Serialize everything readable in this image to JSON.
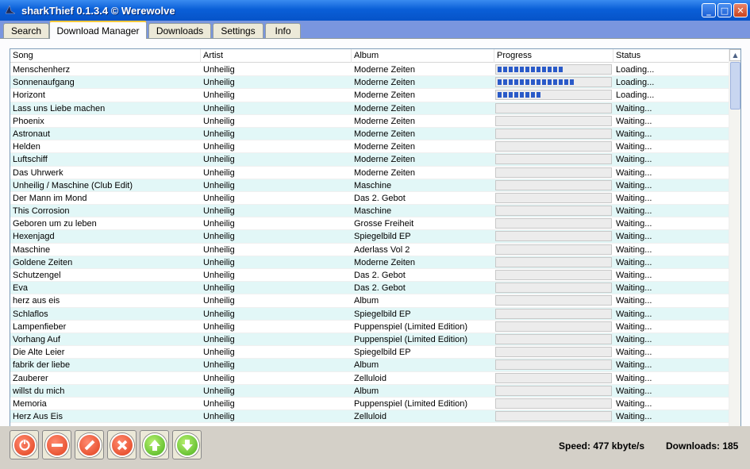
{
  "window": {
    "title": "sharkThief 0.1.3.4 © Werewolve"
  },
  "tabs": [
    {
      "label": "Search"
    },
    {
      "label": "Download Manager"
    },
    {
      "label": "Downloads"
    },
    {
      "label": "Settings"
    },
    {
      "label": "Info"
    }
  ],
  "columns": {
    "song": "Song",
    "artist": "Artist",
    "album": "Album",
    "progress": "Progress",
    "status": "Status"
  },
  "rows": [
    {
      "song": "Menschenherz",
      "artist": "Unheilig",
      "album": "Moderne Zeiten",
      "progress": 0.58,
      "status": "Loading..."
    },
    {
      "song": "Sonnenaufgang",
      "artist": "Unheilig",
      "album": "Moderne Zeiten",
      "progress": 0.68,
      "status": "Loading..."
    },
    {
      "song": "Horizont",
      "artist": "Unheilig",
      "album": "Moderne Zeiten",
      "progress": 0.39,
      "status": "Loading..."
    },
    {
      "song": "Lass uns Liebe machen",
      "artist": "Unheilig",
      "album": "Moderne Zeiten",
      "progress": 0,
      "status": "Waiting..."
    },
    {
      "song": "Phoenix",
      "artist": "Unheilig",
      "album": "Moderne Zeiten",
      "progress": 0,
      "status": "Waiting..."
    },
    {
      "song": "Astronaut",
      "artist": "Unheilig",
      "album": "Moderne Zeiten",
      "progress": 0,
      "status": "Waiting..."
    },
    {
      "song": "Helden",
      "artist": "Unheilig",
      "album": "Moderne Zeiten",
      "progress": 0,
      "status": "Waiting..."
    },
    {
      "song": "Luftschiff",
      "artist": "Unheilig",
      "album": "Moderne Zeiten",
      "progress": 0,
      "status": "Waiting..."
    },
    {
      "song": "Das Uhrwerk",
      "artist": "Unheilig",
      "album": "Moderne Zeiten",
      "progress": 0,
      "status": "Waiting..."
    },
    {
      "song": "Unheilig / Maschine (Club Edit)",
      "artist": "Unheilig",
      "album": "Maschine",
      "progress": 0,
      "status": "Waiting..."
    },
    {
      "song": "Der Mann im Mond",
      "artist": "Unheilig",
      "album": "Das 2. Gebot",
      "progress": 0,
      "status": "Waiting..."
    },
    {
      "song": "This Corrosion",
      "artist": "Unheilig",
      "album": "Maschine",
      "progress": 0,
      "status": "Waiting..."
    },
    {
      "song": "Geboren um zu leben",
      "artist": "Unheilig",
      "album": "Grosse Freiheit",
      "progress": 0,
      "status": "Waiting..."
    },
    {
      "song": "Hexenjagd",
      "artist": "Unheilig",
      "album": "Spiegelbild EP",
      "progress": 0,
      "status": "Waiting..."
    },
    {
      "song": "Maschine",
      "artist": "Unheilig",
      "album": "Aderlass Vol 2",
      "progress": 0,
      "status": "Waiting..."
    },
    {
      "song": "Goldene Zeiten",
      "artist": "Unheilig",
      "album": "Moderne Zeiten",
      "progress": 0,
      "status": "Waiting..."
    },
    {
      "song": "Schutzengel",
      "artist": "Unheilig",
      "album": "Das 2. Gebot",
      "progress": 0,
      "status": "Waiting..."
    },
    {
      "song": "Eva",
      "artist": "Unheilig",
      "album": "Das 2. Gebot",
      "progress": 0,
      "status": "Waiting..."
    },
    {
      "song": "herz aus eis",
      "artist": "Unheilig",
      "album": "Album",
      "progress": 0,
      "status": "Waiting..."
    },
    {
      "song": "Schlaflos",
      "artist": "Unheilig",
      "album": "Spiegelbild EP",
      "progress": 0,
      "status": "Waiting..."
    },
    {
      "song": "Lampenfieber",
      "artist": "Unheilig",
      "album": "Puppenspiel (Limited Edition)",
      "progress": 0,
      "status": "Waiting..."
    },
    {
      "song": "Vorhang Auf",
      "artist": "Unheilig",
      "album": "Puppenspiel (Limited Edition)",
      "progress": 0,
      "status": "Waiting..."
    },
    {
      "song": "Die Alte Leier",
      "artist": "Unheilig",
      "album": "Spiegelbild EP",
      "progress": 0,
      "status": "Waiting..."
    },
    {
      "song": "fabrik der  liebe",
      "artist": "Unheilig",
      "album": "Album",
      "progress": 0,
      "status": "Waiting..."
    },
    {
      "song": "Zauberer",
      "artist": "Unheilig",
      "album": "Zelluloid",
      "progress": 0,
      "status": "Waiting..."
    },
    {
      "song": "willst du mich",
      "artist": "Unheilig",
      "album": "Album",
      "progress": 0,
      "status": "Waiting..."
    },
    {
      "song": "Memoria",
      "artist": "Unheilig",
      "album": "Puppenspiel (Limited Edition)",
      "progress": 0,
      "status": "Waiting..."
    },
    {
      "song": "Herz Aus Eis",
      "artist": "Unheilig",
      "album": "Zelluloid",
      "progress": 0,
      "status": "Waiting..."
    }
  ],
  "actions": [
    {
      "name": "power-button",
      "icon": "power-icon",
      "color": "red"
    },
    {
      "name": "remove-button",
      "icon": "minus-icon",
      "color": "red"
    },
    {
      "name": "clear-button",
      "icon": "slash-icon",
      "color": "red"
    },
    {
      "name": "cancel-button",
      "icon": "x-icon",
      "color": "red"
    },
    {
      "name": "move-up-button",
      "icon": "arrow-up-icon",
      "color": "green"
    },
    {
      "name": "move-down-button",
      "icon": "arrow-down-icon",
      "color": "green"
    }
  ],
  "status": {
    "speed": "Speed: 477 kbyte/s",
    "downloads": "Downloads: 185"
  },
  "colors": {
    "progress_fill": "#2a5ac8",
    "row_alt": "#e2f7f7",
    "titlebar": "#0a5fd8"
  }
}
